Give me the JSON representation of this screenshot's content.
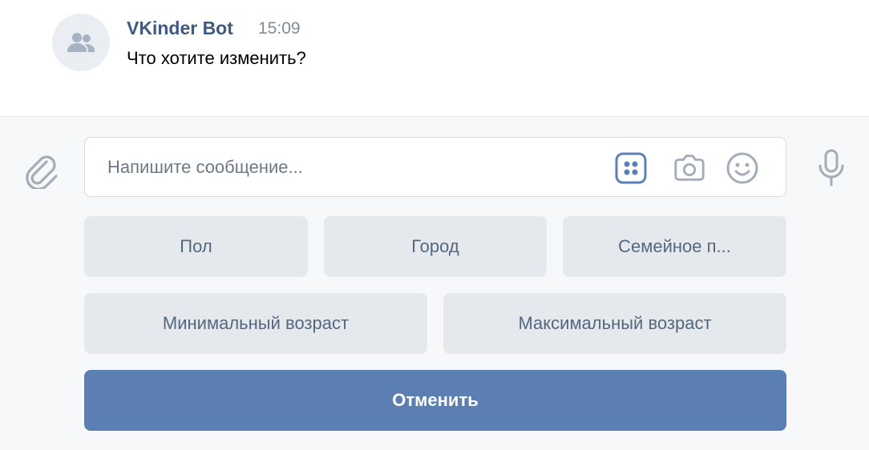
{
  "message": {
    "author": "VKinder Bot",
    "time": "15:09",
    "text": "Что хотите изменить?",
    "avatar_icon": "users-icon"
  },
  "composer": {
    "placeholder": "Напишите сообщение...",
    "value": "",
    "icons": {
      "attach": "paperclip-icon",
      "keyboard": "bot-keyboard-icon",
      "camera": "camera-icon",
      "emoji": "smile-icon",
      "mic": "microphone-icon"
    }
  },
  "keyboard": {
    "row1": [
      "Пол",
      "Город",
      "Семейное п..."
    ],
    "row2": [
      "Минимальный возраст",
      "Максимальный возраст"
    ],
    "cancel": "Отменить"
  },
  "colors": {
    "author": "#3f5a82",
    "accent": "#5b7fb3",
    "key_bg": "#e5e9ee",
    "key_text": "#55677d",
    "active_icon": "#5b80b8"
  }
}
